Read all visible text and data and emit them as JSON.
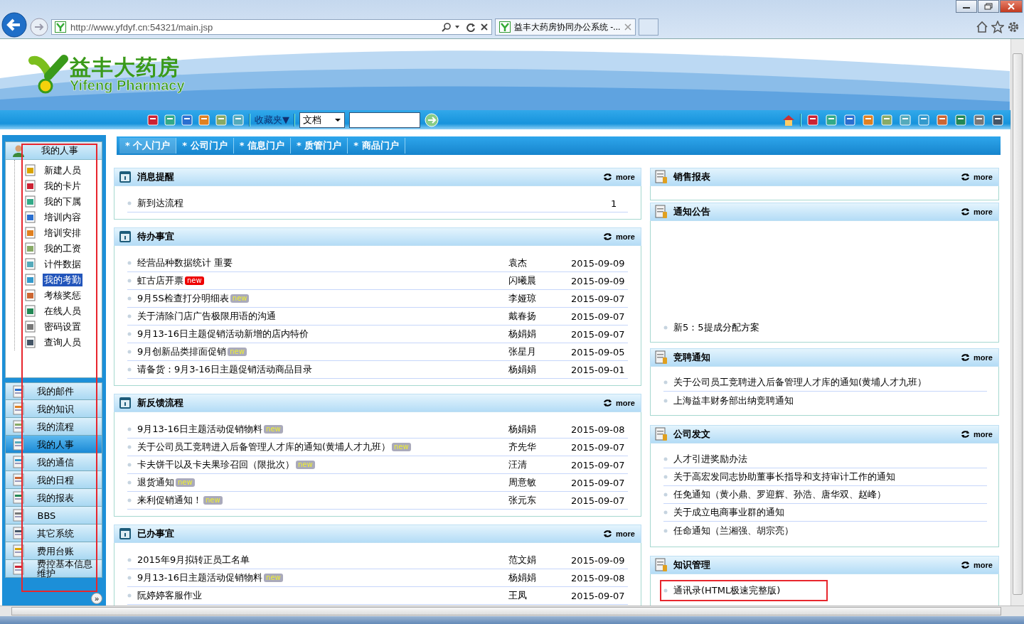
{
  "browser": {
    "url": "http://www.yfdyf.cn:54321/main.jsp",
    "tab_title": "益丰大药房协同办公系统 -..."
  },
  "header": {
    "logo_cn": "益丰大药房",
    "logo_en": "Yifeng Pharmacy"
  },
  "toolbar": {
    "favorites": "收藏夹▼",
    "search_scope": "文档"
  },
  "sidebar": {
    "section": "我的人事",
    "items": [
      {
        "label": "新建人员",
        "selected": false
      },
      {
        "label": "我的卡片",
        "selected": false
      },
      {
        "label": "我的下属",
        "selected": false
      },
      {
        "label": "培训内容",
        "selected": false
      },
      {
        "label": "培训安排",
        "selected": false
      },
      {
        "label": "我的工资",
        "selected": false
      },
      {
        "label": "计件数据",
        "selected": false
      },
      {
        "label": "我的考勤",
        "selected": true
      },
      {
        "label": "考核奖惩",
        "selected": false
      },
      {
        "label": "在线人员",
        "selected": false
      },
      {
        "label": "密码设置",
        "selected": false
      },
      {
        "label": "查询人员",
        "selected": false
      }
    ],
    "modules": [
      {
        "label": "我的邮件",
        "selected": false
      },
      {
        "label": "我的知识",
        "selected": false
      },
      {
        "label": "我的流程",
        "selected": false
      },
      {
        "label": "我的人事",
        "selected": true
      },
      {
        "label": "我的通信",
        "selected": false
      },
      {
        "label": "我的日程",
        "selected": false
      },
      {
        "label": "我的报表",
        "selected": false
      },
      {
        "label": "BBS",
        "selected": false
      },
      {
        "label": "其它系统",
        "selected": false
      },
      {
        "label": "费用台账",
        "selected": false
      },
      {
        "label": "费控基本信息维护",
        "selected": false
      }
    ],
    "collapse": "»"
  },
  "portal_tabs": [
    {
      "label": "* 个人门户",
      "selected": true
    },
    {
      "label": "* 公司门户",
      "selected": false
    },
    {
      "label": "* 信息门户",
      "selected": false
    },
    {
      "label": "* 质管门户",
      "selected": false
    },
    {
      "label": "* 商品门户",
      "selected": false
    }
  ],
  "left_panels": [
    {
      "title": "消息提醒",
      "more": "more",
      "rows": [
        {
          "title": "新到达流程",
          "count": "1"
        }
      ]
    },
    {
      "title": "待办事宜",
      "more": "more",
      "rows": [
        {
          "title": "经营品种数据统计  重要",
          "person": "袁杰",
          "date": "2015-09-09"
        },
        {
          "title": "虹古店开票",
          "badge": {
            "text": "new",
            "kind": "red"
          },
          "person": "闪曦晨",
          "date": "2015-09-09"
        },
        {
          "title": "9月5S检查打分明细表",
          "badge": {
            "text": "new",
            "kind": "plain"
          },
          "person": "李娅琼",
          "date": "2015-09-07"
        },
        {
          "title": "关于清除门店广告极限用语的沟通",
          "person": "戴春扬",
          "date": "2015-09-07"
        },
        {
          "title": "9月13-16日主题促销活动新增的店内特价",
          "person": "杨娟娟",
          "date": "2015-09-07"
        },
        {
          "title": "9月创新品类排面促销",
          "badge": {
            "text": "new",
            "kind": "plain"
          },
          "person": "张星月",
          "date": "2015-09-05"
        },
        {
          "title": "请备货：9月3-16日主题促销活动商品目录",
          "person": "杨娟娟",
          "date": "2015-09-01"
        }
      ]
    },
    {
      "title": "新反馈流程",
      "more": "more",
      "rows": [
        {
          "title": "9月13-16日主题活动促销物料",
          "badge": {
            "text": "new",
            "kind": "plain"
          },
          "person": "杨娟娟",
          "date": "2015-09-08"
        },
        {
          "title": "关于公司员工竞聘进入后备管理人才库的通知(黄埔人才九班）",
          "badge": {
            "text": "new",
            "kind": "plain"
          },
          "person": "齐先华",
          "date": "2015-09-07"
        },
        {
          "title": "卡夫饼干以及卡夫果珍召回（限批次）",
          "badge": {
            "text": "new",
            "kind": "plain"
          },
          "person": "汪清",
          "date": "2015-09-07"
        },
        {
          "title": "退货通知",
          "badge": {
            "text": "new",
            "kind": "plain"
          },
          "person": "周意敏",
          "date": "2015-09-07"
        },
        {
          "title": "来利促销通知！",
          "badge": {
            "text": "new",
            "kind": "plain"
          },
          "person": "张元东",
          "date": "2015-09-07"
        }
      ]
    },
    {
      "title": "已办事宜",
      "more": "more",
      "rows": [
        {
          "title": "2015年9月拟转正员工名单",
          "person": "范文娟",
          "date": "2015-09-09"
        },
        {
          "title": "9月13-16日主题活动促销物料",
          "badge": {
            "text": "new",
            "kind": "plain"
          },
          "person": "杨娟娟",
          "date": "2015-09-08"
        },
        {
          "title": "阮婷婷客服作业",
          "person": "王凤",
          "date": "2015-09-07"
        }
      ]
    }
  ],
  "right_panels": [
    {
      "title": "销售报表",
      "more": "more"
    },
    {
      "title": "通知公告",
      "more": "more",
      "rows": [
        {
          "title": "新5：5提成分配方案"
        }
      ]
    },
    {
      "title": "竞聘通知",
      "more": "more",
      "rows": [
        {
          "title": "关于公司员工竞聘进入后备管理人才库的通知(黄埔人才九班）"
        },
        {
          "title": "上海益丰财务部出纳竞聘通知"
        }
      ]
    },
    {
      "title": "公司发文",
      "more": "more",
      "rows": [
        {
          "title": "人才引进奖励办法"
        },
        {
          "title": "关于高宏发同志协助董事长指导和支持审计工作的通知"
        },
        {
          "title": "任免通知（黄小鼎、罗迎辉、孙浩、唐华双、赵峰）"
        },
        {
          "title": "关于成立电商事业群的通知"
        },
        {
          "title": "任命通知（兰湘强、胡宗亮）"
        }
      ]
    },
    {
      "title": "知识管理",
      "more": "more",
      "rows": [
        {
          "title": "通讯录(HTML极速完整版)"
        }
      ]
    }
  ]
}
